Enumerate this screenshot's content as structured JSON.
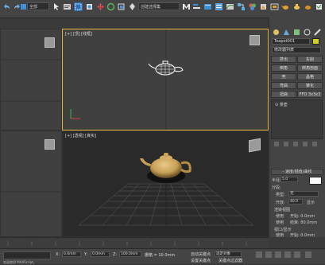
{
  "toolbar": {
    "select_filter": "全部",
    "named_selection": "创建选择集"
  },
  "viewports": {
    "top": "[+] [顶] [线框]",
    "perspective": "[+] [透视] [真实]"
  },
  "command_panel": {
    "object_name": "Teapot001",
    "modifier_list": "修改器列表",
    "buttons": [
      "挤出",
      "车削",
      "倒角",
      "倒角剖面",
      "壳",
      "晶格",
      "弯曲",
      "锥化",
      "扭曲",
      "FFD 3x3x3"
    ],
    "stack_item": "⊙ 茶壶",
    "rollout_title": "- 速度/插值/曲线",
    "radius_label": "半径:",
    "radius_value": "5.0",
    "segments_label": "分段:",
    "type_label": "类型:",
    "type_value": "无",
    "open_label": "开放:",
    "open_value": "40.0",
    "show_label": "显示",
    "section1": "渲染视图",
    "check1": "使用",
    "check1_field": "开始: 0.0mm",
    "check2": "使用",
    "check2_field": "结束: 80.0mm",
    "section2": "视口/显示",
    "check3": "使用",
    "check3_field": "开始: 0.0mm",
    "check4": "使用",
    "check4_field": "结束: 80.0mm"
  },
  "status": {
    "x": "0.0mm",
    "y": "0.0mm",
    "z": "100.0mm",
    "grid": "栅格 = 10.0mm",
    "autokey": "自动关键点",
    "set_key": "设置关键点",
    "selected": "选定对象",
    "key_filter": "关键点过滤器",
    "welcome": "欢迎使用 MAXScript。"
  },
  "colors": {
    "viewport_active_border": "#e3b53c",
    "teapot": "#c7a055"
  }
}
